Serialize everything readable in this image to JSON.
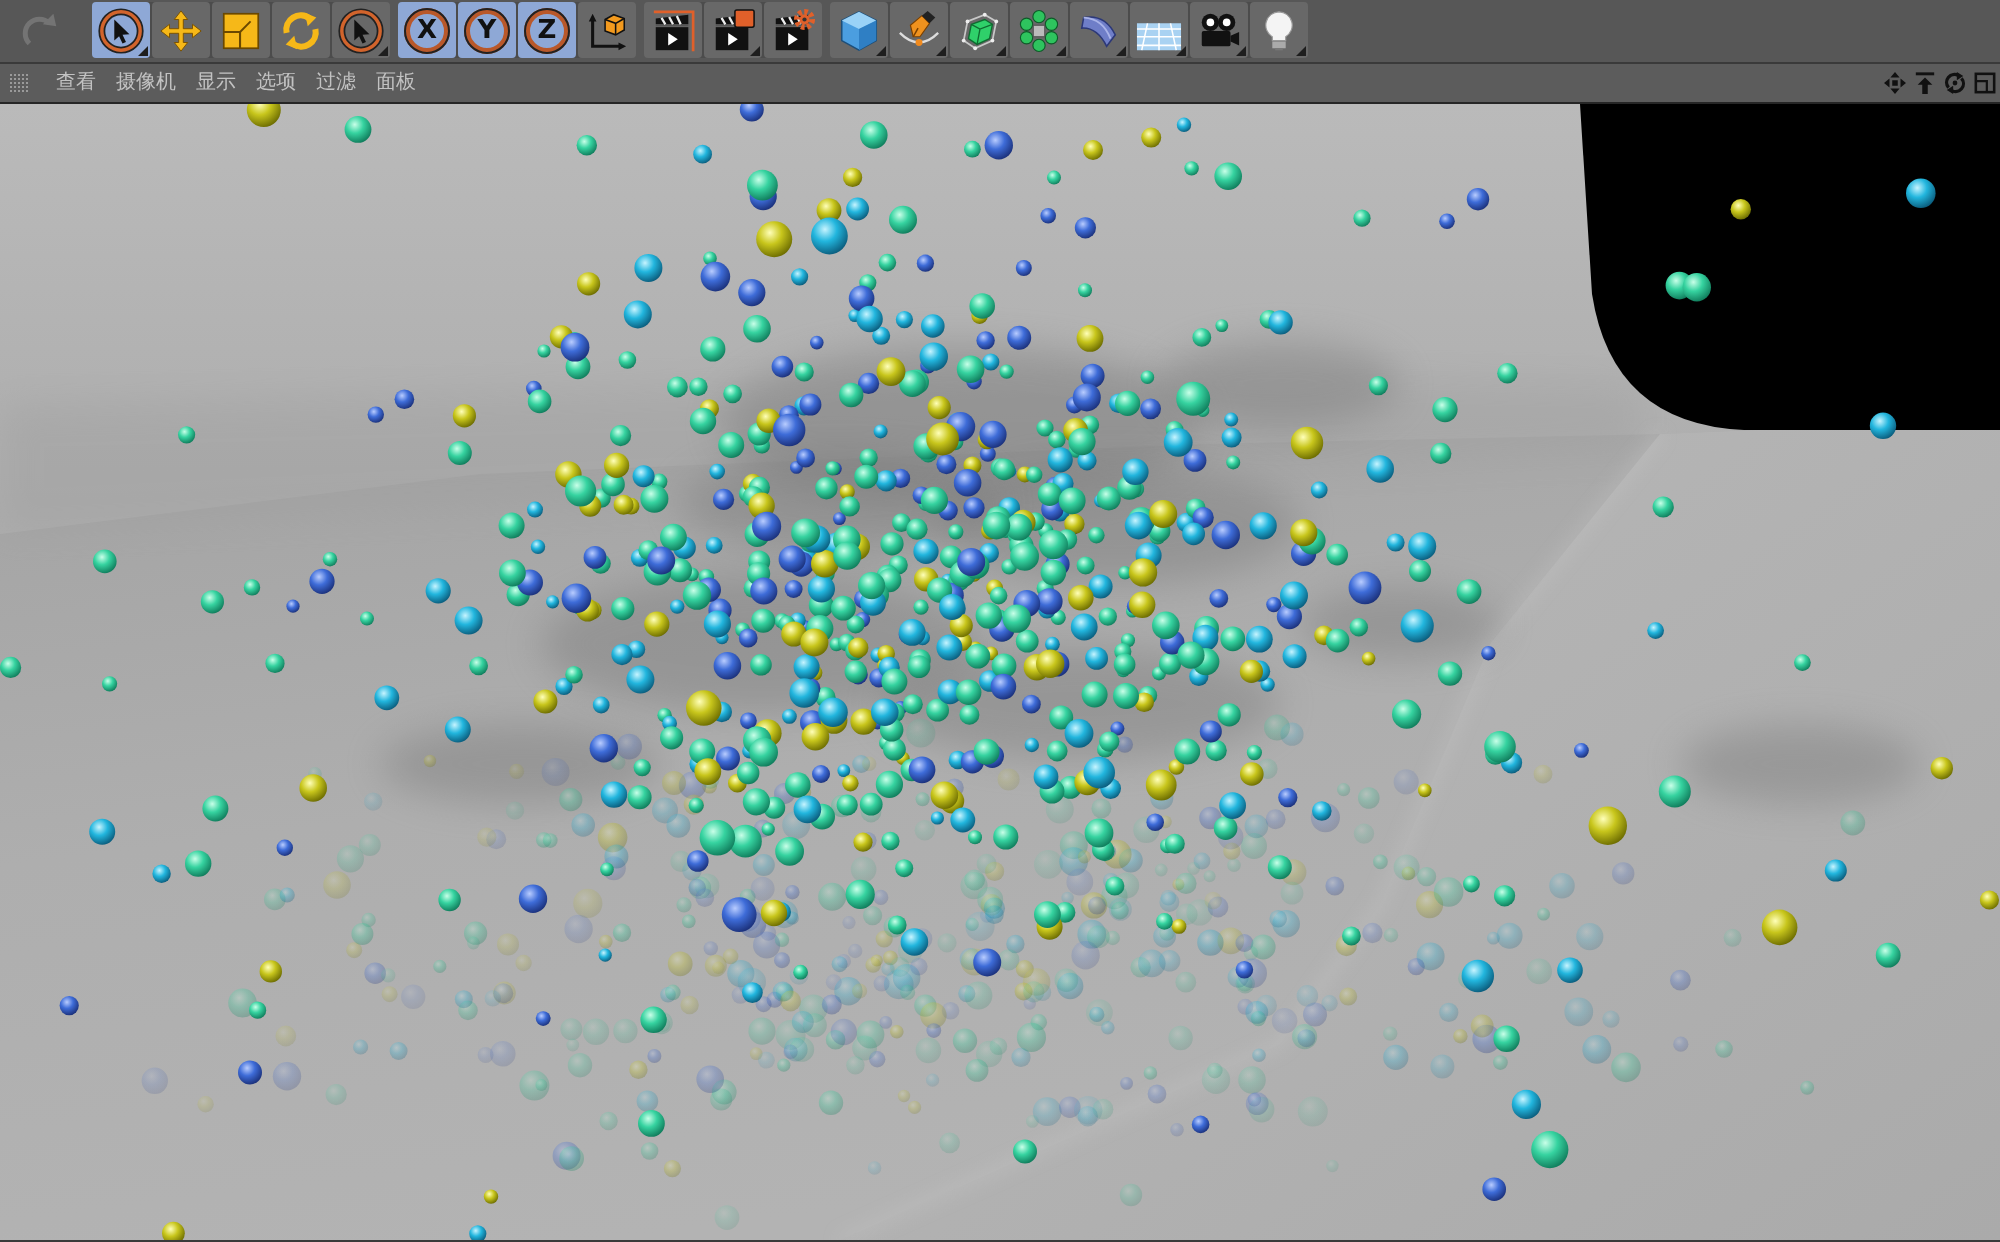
{
  "toolbar": {
    "history_button": {
      "disabled": true
    },
    "groups": [
      {
        "items": [
          {
            "kind": "select",
            "selected": true,
            "submenu": true
          },
          {
            "kind": "move",
            "selected": false,
            "submenu": false
          },
          {
            "kind": "scale",
            "selected": false,
            "submenu": false
          },
          {
            "kind": "rotate",
            "selected": false,
            "submenu": false
          },
          {
            "kind": "liveselect",
            "selected": false,
            "submenu": true
          }
        ]
      },
      {
        "items": [
          {
            "kind": "axis",
            "label": "X",
            "selected": true,
            "submenu": false
          },
          {
            "kind": "axis",
            "label": "Y",
            "selected": true,
            "submenu": false
          },
          {
            "kind": "axis",
            "label": "Z",
            "selected": true,
            "submenu": false
          },
          {
            "kind": "coordinates",
            "selected": false,
            "submenu": false
          }
        ]
      },
      {
        "items": [
          {
            "kind": "renderview",
            "selected": false,
            "submenu": false
          },
          {
            "kind": "renderpicture",
            "selected": false,
            "submenu": true
          },
          {
            "kind": "rendersettings",
            "selected": false,
            "submenu": false
          }
        ]
      },
      {
        "items": [
          {
            "kind": "cube",
            "selected": false,
            "submenu": true
          },
          {
            "kind": "pen",
            "selected": false,
            "submenu": true
          },
          {
            "kind": "subdivision",
            "selected": false,
            "submenu": true
          },
          {
            "kind": "cloner",
            "selected": false,
            "submenu": true
          },
          {
            "kind": "deformer",
            "selected": false,
            "submenu": true
          },
          {
            "kind": "floor",
            "selected": false,
            "submenu": true
          },
          {
            "kind": "camera",
            "selected": false,
            "submenu": true
          },
          {
            "kind": "light",
            "selected": false,
            "submenu": true
          }
        ]
      }
    ]
  },
  "viewport_menu": [
    "查看",
    "摄像机",
    "显示",
    "选项",
    "过滤",
    "面板"
  ]
}
